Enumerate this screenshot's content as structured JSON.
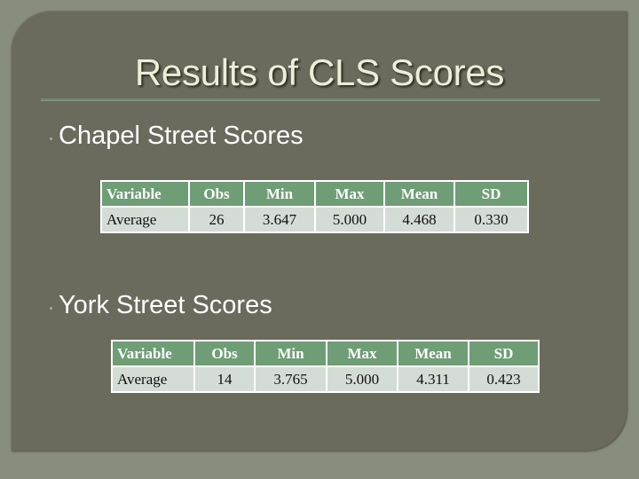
{
  "slide": {
    "title": "Results of CLS Scores",
    "sections": [
      {
        "heading": "Chapel Street Scores",
        "table": {
          "columns": [
            "Variable",
            "Obs",
            "Min",
            "Max",
            "Mean",
            "SD"
          ],
          "rows": [
            [
              "Average",
              "26",
              "3.647",
              "5.000",
              "4.468",
              "0.330"
            ]
          ]
        }
      },
      {
        "heading": "York Street Scores",
        "table": {
          "columns": [
            "Variable",
            "Obs",
            "Min",
            "Max",
            "Mean",
            "SD"
          ],
          "rows": [
            [
              "Average",
              "14",
              "3.765",
              "5.000",
              "4.311",
              "0.423"
            ]
          ]
        }
      }
    ]
  },
  "colors": {
    "background": "#898d7d",
    "panel": "#6a6a5d",
    "title_text": "#eceed8",
    "table_header": "#6f9d76",
    "table_body": "#d4dcd6"
  }
}
